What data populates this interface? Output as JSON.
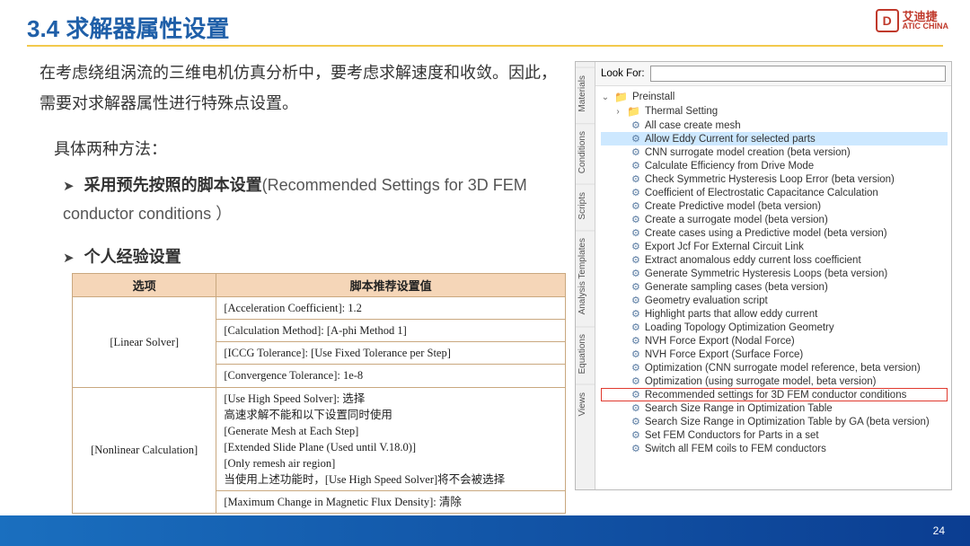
{
  "page": {
    "section_title": "3.4 求解器属性设置",
    "slide_number": "24"
  },
  "logo": {
    "mark": "D",
    "cn": "艾迪捷",
    "en": "ATIC CHINA"
  },
  "intro": {
    "p1": "在考虑绕组涡流的三维电机仿真分析中，要考虑求解速度和收敛。因此，需要对求解器属性进行特殊点设置。",
    "p2": "具体两种方法：",
    "bullet1_bold": "采用预先按照的脚本设置",
    "bullet1_rest": "(Recommended Settings for 3D FEM conductor conditions ）",
    "bullet2_bold": "个人经验设置"
  },
  "table": {
    "headers": [
      "选项",
      "脚本推荐设置值"
    ],
    "rows": [
      {
        "rowhead": "[Linear Solver]",
        "lines": [
          "[Acceleration Coefficient]: 1.2",
          "[Calculation Method]: [A-phi Method 1]",
          "[ICCG Tolerance]: [Use Fixed Tolerance per Step]",
          "[Convergence Tolerance]: 1e-8"
        ]
      },
      {
        "rowhead": "[Nonlinear Calculation]",
        "lines": [
          "[Use High Speed Solver]: 选择\n高速求解不能和以下设置同时使用\n[Generate Mesh at Each Step]\n[Extended Slide Plane (Used until V.18.0)]\n[Only remesh air region]\n当使用上述功能时，[Use High Speed Solver]将不会被选择",
          "[Maximum Change in Magnetic Flux Density]: 清除"
        ]
      }
    ]
  },
  "app": {
    "lookfor_label": "Look For:",
    "lookfor_value": "",
    "sidetabs": [
      "Materials",
      "Conditions",
      "Scripts",
      "Analysis Templates",
      "Equations",
      "Views"
    ],
    "tree": {
      "root": "Preinstall",
      "child_folder": "Thermal Setting",
      "items": [
        {
          "label": "All case create mesh",
          "hl": ""
        },
        {
          "label": "Allow Eddy Current for selected parts",
          "hl": "blue"
        },
        {
          "label": "CNN surrogate model creation (beta version)",
          "hl": ""
        },
        {
          "label": "Calculate Efficiency from Drive Mode",
          "hl": ""
        },
        {
          "label": "Check Symmetric Hysteresis Loop Error (beta version)",
          "hl": ""
        },
        {
          "label": "Coefficient of Electrostatic Capacitance Calculation",
          "hl": ""
        },
        {
          "label": "Create Predictive model (beta version)",
          "hl": ""
        },
        {
          "label": "Create a surrogate model (beta version)",
          "hl": ""
        },
        {
          "label": "Create cases using a Predictive model (beta version)",
          "hl": ""
        },
        {
          "label": "Export Jcf For External Circuit Link",
          "hl": ""
        },
        {
          "label": "Extract anomalous eddy current loss coefficient",
          "hl": ""
        },
        {
          "label": "Generate Symmetric Hysteresis Loops (beta version)",
          "hl": ""
        },
        {
          "label": "Generate sampling cases (beta version)",
          "hl": ""
        },
        {
          "label": "Geometry evaluation script",
          "hl": ""
        },
        {
          "label": "Highlight parts that allow eddy current",
          "hl": ""
        },
        {
          "label": "Loading Topology Optimization Geometry",
          "hl": ""
        },
        {
          "label": "NVH Force Export (Nodal Force)",
          "hl": ""
        },
        {
          "label": "NVH Force Export (Surface Force)",
          "hl": ""
        },
        {
          "label": "Optimization (CNN surrogate model reference, beta version)",
          "hl": ""
        },
        {
          "label": "Optimization (using surrogate model, beta version)",
          "hl": ""
        },
        {
          "label": "Recommended settings for 3D FEM conductor conditions",
          "hl": "red"
        },
        {
          "label": "Search Size Range in Optimization Table",
          "hl": ""
        },
        {
          "label": "Search Size Range in Optimization Table by GA (beta version)",
          "hl": ""
        },
        {
          "label": "Set FEM Conductors for Parts in a set",
          "hl": ""
        },
        {
          "label": "Switch all FEM coils to FEM conductors",
          "hl": ""
        }
      ]
    }
  }
}
